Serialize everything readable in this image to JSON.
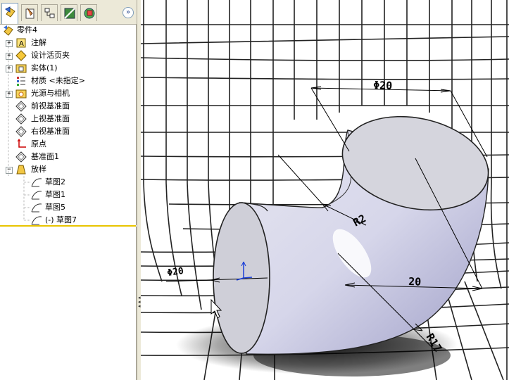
{
  "feature_tree": {
    "root": "零件4",
    "items": [
      {
        "label": "注解"
      },
      {
        "label": "设计活页夹"
      },
      {
        "label": "实体(1)"
      },
      {
        "label": "材质 <未指定>"
      },
      {
        "label": "光源与相机"
      },
      {
        "label": "前视基准面"
      },
      {
        "label": "上视基准面"
      },
      {
        "label": "右视基准面"
      },
      {
        "label": "原点"
      },
      {
        "label": "基准面1"
      },
      {
        "label": "放样"
      }
    ],
    "sub_items": [
      {
        "label": "草图2"
      },
      {
        "label": "草图1"
      },
      {
        "label": "草图5"
      },
      {
        "label": "(-) 草图7"
      }
    ]
  },
  "tabs": [
    "feature-manager-icon",
    "property-manager-icon",
    "configuration-manager-icon",
    "dimxpert-icon",
    "display-manager-icon"
  ],
  "viewport": {
    "dimensions": {
      "top_diameter": "Φ20",
      "radius_small": "R2",
      "width": "20",
      "radius_large": "R17",
      "left_diameter": "Φ20"
    }
  },
  "colors": {
    "panel_bg": "#ece9d8",
    "separator": "#e8c400",
    "model_face": "#d8d8e6",
    "grid": "#222222"
  }
}
